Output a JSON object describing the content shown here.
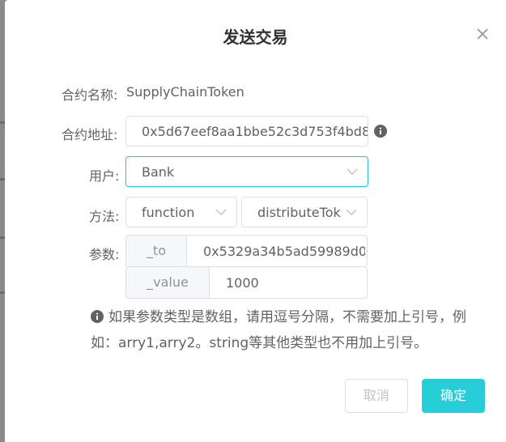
{
  "dialog": {
    "title": "发送交易",
    "contract_name_label": "合约名称:",
    "contract_name": "SupplyChainToken",
    "contract_address_label": "合约地址:",
    "contract_address": "0x5d67eef8aa1bbe52c3d753f4bd8",
    "user_label": "用户:",
    "user_value": "Bank",
    "method_label": "方法:",
    "method_type": "function",
    "method_name": "distributeTok",
    "params_label": "参数:",
    "params": [
      {
        "name": "_to",
        "value": "0x5329a34b5ad59989d0"
      },
      {
        "name": "_value",
        "value": "1000"
      }
    ],
    "tip": "如果参数类型是数组，请用逗号分隔，不需要加上引号，例如：arry1,arry2。string等其他类型也不用加上引号。",
    "cancel_label": "取消",
    "confirm_label": "确定"
  },
  "colors": {
    "accent": "#26cfd8",
    "text": "#606266",
    "border": "#dcdfe6",
    "overlay": "#8a8a8a"
  },
  "icons": [
    "close-icon",
    "info-icon",
    "chevron-down-icon"
  ]
}
